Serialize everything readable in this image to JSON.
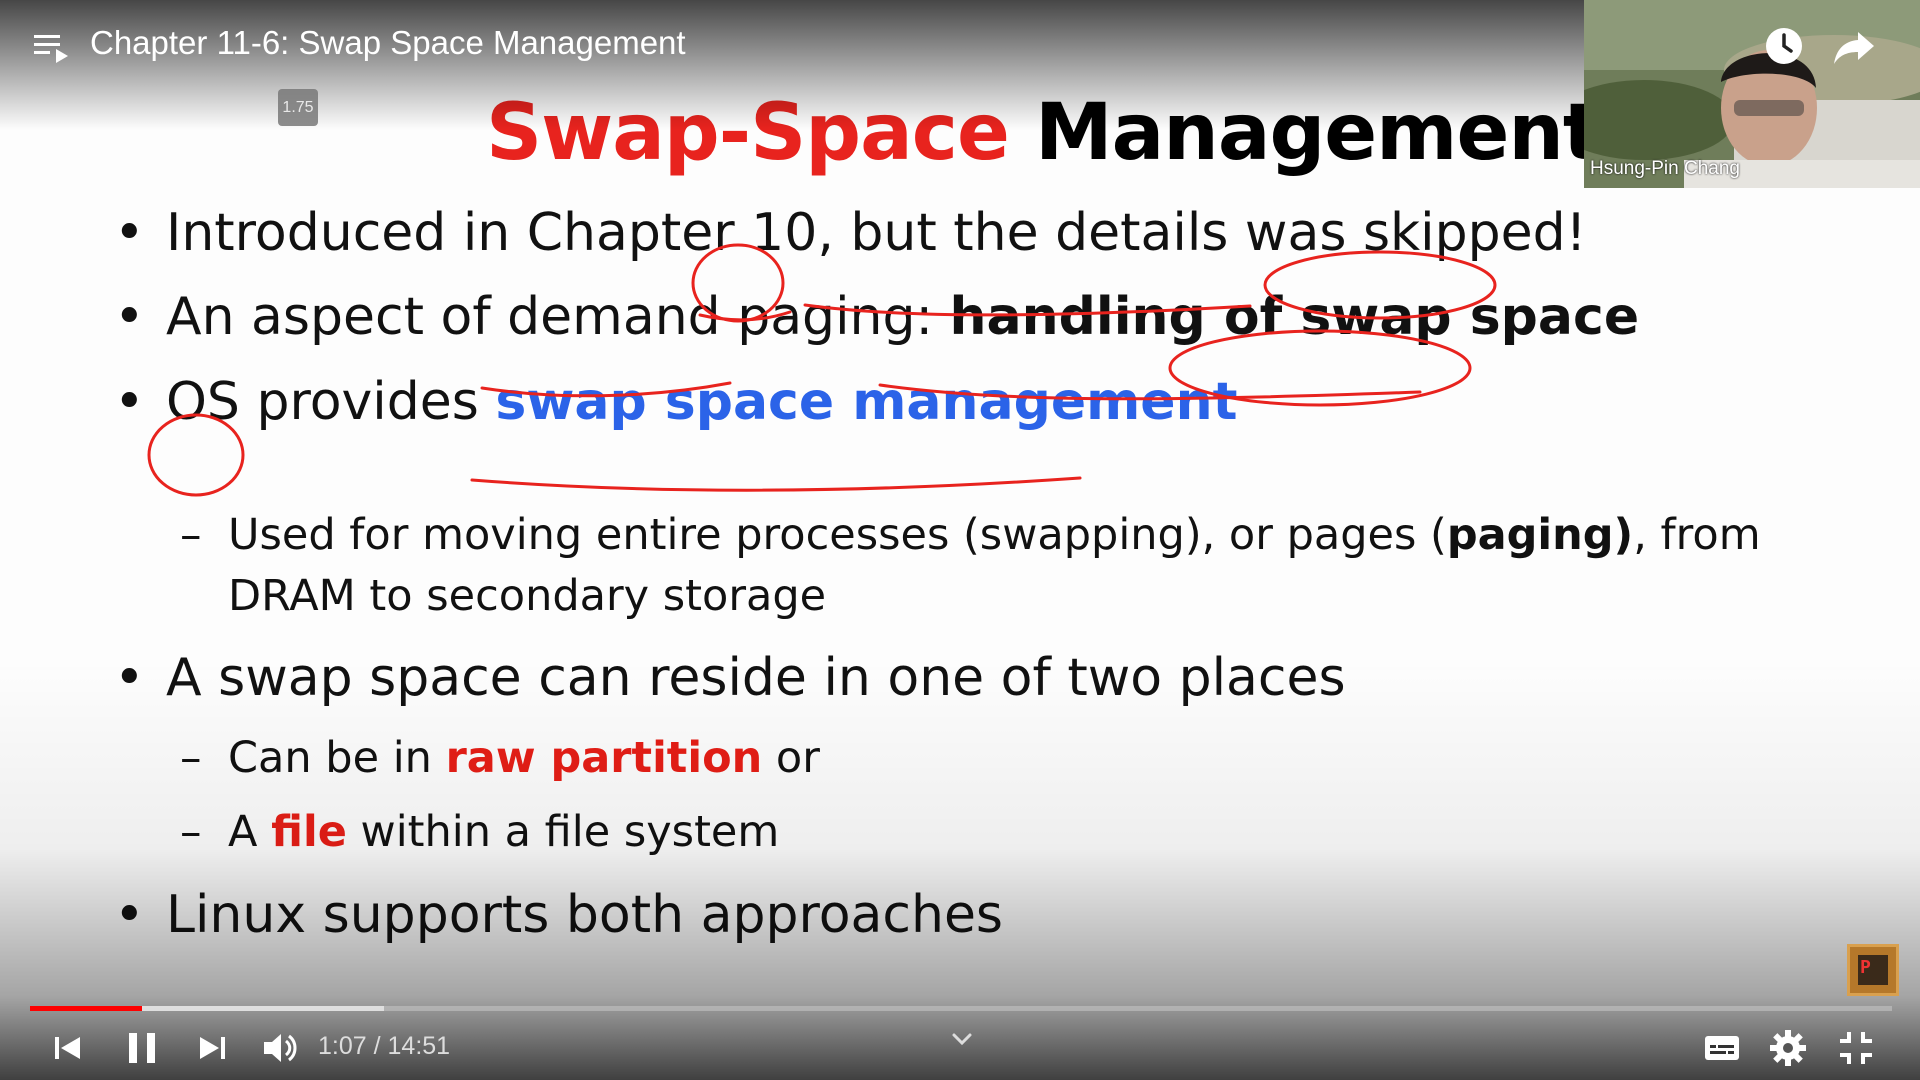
{
  "player": {
    "title": "Chapter 11-6: Swap Space Management",
    "speed": "1.75",
    "time_current": "1:07",
    "time_separator": " / ",
    "time_total": "14:51",
    "progress_played_fraction": 0.0604,
    "progress_buffered_fraction": 0.19,
    "accent_color": "#ff0000"
  },
  "webcam": {
    "name": "Hsung-Pin Chang"
  },
  "slide": {
    "title_red": "Swap-Space",
    "title_black": "Management",
    "bullets": [
      {
        "dot": "•",
        "text": "Introduced in Chapter 10, but the details was skipped!"
      },
      {
        "dot": "•",
        "plain": "An aspect of demand paging: ",
        "bold": "handling of swap space"
      },
      {
        "dot": "•",
        "plain": "OS provides ",
        "blue": "swap space management"
      },
      {
        "dash": "–",
        "a": "Used for moving entire processes (swapping), or pages (",
        "bold": "paging)",
        "b": ", from",
        "line2": "DRAM to secondary storage"
      },
      {
        "dot": "•",
        "text": "A swap space can reside in one of two places"
      },
      {
        "dash": "–",
        "a": "Can be in ",
        "red": "raw partition",
        "b": " or"
      },
      {
        "dash": "–",
        "a": "A ",
        "red": "file",
        "b": " within a file system"
      },
      {
        "dot": "•",
        "text": "Linux supports both approaches"
      }
    ]
  },
  "icons": {
    "playlist": "playlist-icon",
    "watch_later": "clock-icon",
    "share": "share-icon",
    "prev": "skip-previous-icon",
    "pause": "pause-icon",
    "next": "skip-next-icon",
    "volume": "volume-icon",
    "chevron": "chevron-down-icon",
    "captions": "subtitles-icon",
    "settings": "gear-icon",
    "exit_fullscreen": "exit-fullscreen-icon",
    "corner_logo": "channel-logo-icon"
  }
}
